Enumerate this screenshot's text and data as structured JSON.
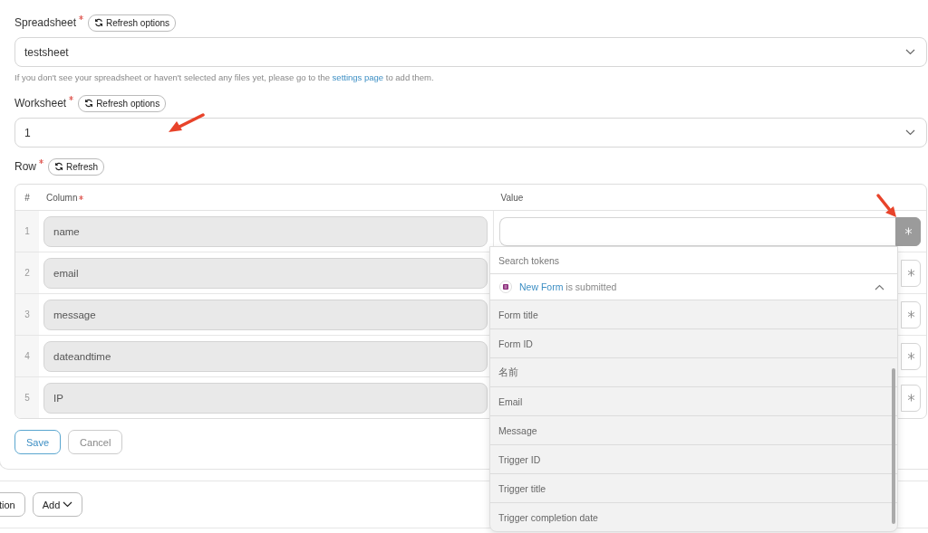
{
  "spreadsheet": {
    "label": "Spreadsheet",
    "required": true,
    "refresh_button": "Refresh options",
    "value": "testsheet"
  },
  "help": {
    "before": "If you don't see your spreadsheet or haven't selected any files yet, please go to the ",
    "link": "settings page",
    "after": " to add them."
  },
  "worksheet": {
    "label": "Worksheet",
    "required": true,
    "refresh_button": "Refresh options",
    "value": "1"
  },
  "row": {
    "label": "Row",
    "required": true,
    "refresh_button": "Refresh"
  },
  "table": {
    "columns": [
      {
        "label": "#",
        "required": false
      },
      {
        "label": "Column",
        "required": true
      },
      {
        "label": "Value",
        "required": false
      }
    ],
    "rows": [
      {
        "index": "1",
        "column": "name",
        "open": true
      },
      {
        "index": "2",
        "column": "email",
        "open": false
      },
      {
        "index": "3",
        "column": "message",
        "open": false
      },
      {
        "index": "4",
        "column": "dateandtime",
        "open": false
      },
      {
        "index": "5",
        "column": "IP",
        "open": false
      }
    ]
  },
  "buttons": [
    {
      "label": "Save",
      "kind": "primary"
    },
    {
      "label": "Cancel",
      "kind": "secondary"
    }
  ],
  "bottom_bar": [
    {
      "label": "tion",
      "dropdown": false
    },
    {
      "label": "Add",
      "dropdown": true
    }
  ],
  "token_menu": {
    "search_placeholder": "Search tokens",
    "group": {
      "name": "New Form",
      "event": "is submitted",
      "expanded": true,
      "tokens": [
        "Form title",
        "Form ID",
        "名前",
        "Email",
        "Message",
        "Trigger ID",
        "Trigger title",
        "Trigger completion date"
      ]
    }
  }
}
